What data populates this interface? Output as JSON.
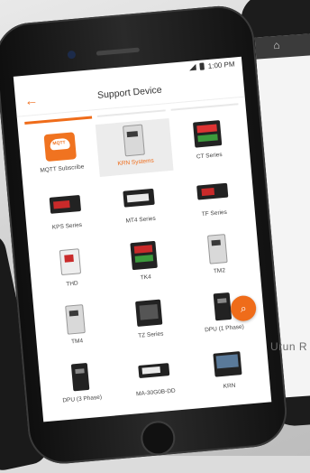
{
  "status": {
    "time": "1:00 PM"
  },
  "header": {
    "title": "Support Device",
    "back_icon": "arrow-left-icon"
  },
  "tabs": [
    "tab-1",
    "tab-2",
    "tab-3"
  ],
  "devices": [
    {
      "label": "MQTT Subscribe",
      "icon": "cloud-icon",
      "cloud_text": "MQTT"
    },
    {
      "label": "KRN Systems",
      "icon": "din-device-icon",
      "selected": true
    },
    {
      "label": "CT Series",
      "icon": "panel-meter-icon"
    },
    {
      "label": "KPS Series",
      "icon": "panel-meter-icon"
    },
    {
      "label": "MT4 Series",
      "icon": "panel-meter-icon"
    },
    {
      "label": "TF Series",
      "icon": "panel-meter-icon"
    },
    {
      "label": "THD",
      "icon": "sensor-icon"
    },
    {
      "label": "TK4",
      "icon": "panel-meter-icon"
    },
    {
      "label": "TM2",
      "icon": "din-device-icon"
    },
    {
      "label": "TM4",
      "icon": "din-device-icon"
    },
    {
      "label": "TZ Series",
      "icon": "panel-meter-icon"
    },
    {
      "label": "DPU (1 Phase)",
      "icon": "din-device-icon"
    },
    {
      "label": "DPU (3 Phase)",
      "icon": "din-device-icon"
    },
    {
      "label": "MA-30G0B-DD",
      "icon": "panel-meter-icon"
    },
    {
      "label": "KRN",
      "icon": "panel-meter-icon"
    }
  ],
  "fab": {
    "icon": "search-icon"
  },
  "overlay_text": "Urun R"
}
